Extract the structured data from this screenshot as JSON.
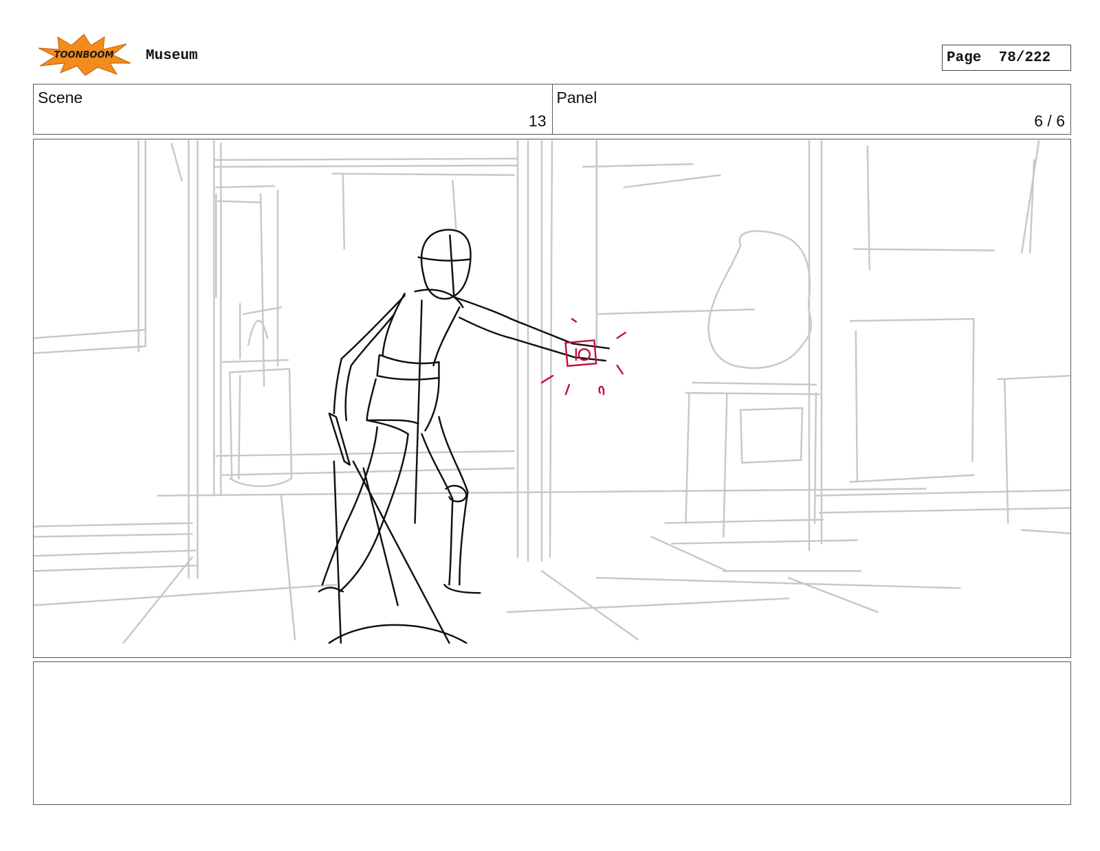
{
  "header": {
    "logo_text": "TOONBOOM",
    "project_title": "Museum",
    "page_label": "Page",
    "page_value": "78/222"
  },
  "info": {
    "scene_label": "Scene",
    "scene_value": "13",
    "panel_label": "Panel",
    "panel_value": "6 / 6"
  },
  "colors": {
    "background_sketch": "#c8c8c8",
    "figure_line": "#111111",
    "accent_red": "#c0143c",
    "logo_orange": "#f28c1c"
  }
}
